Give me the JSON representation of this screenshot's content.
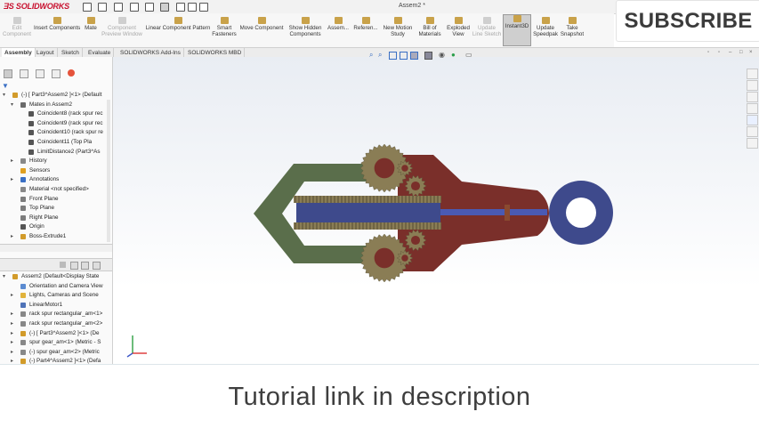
{
  "app": {
    "logo_text": "SOLIDWORKS",
    "doc_title": "Assem2 *"
  },
  "subscribe_label": "SUBSCRIBE",
  "caption": "Tutorial link in description",
  "commands": [
    {
      "label": "Edit\nComponent",
      "enabled": false
    },
    {
      "label": "Insert Components",
      "enabled": true
    },
    {
      "label": "Mate",
      "enabled": true
    },
    {
      "label": "Component\nPreview Window",
      "enabled": false
    },
    {
      "label": "Linear Component Pattern",
      "enabled": true
    },
    {
      "label": "Smart\nFasteners",
      "enabled": true
    },
    {
      "label": "Move Component",
      "enabled": true
    },
    {
      "label": "Show Hidden\nComponents",
      "enabled": true
    },
    {
      "label": "Assem...",
      "enabled": true
    },
    {
      "label": "Referen...",
      "enabled": true
    },
    {
      "label": "New Motion\nStudy",
      "enabled": true
    },
    {
      "label": "Bill of\nMaterials",
      "enabled": true
    },
    {
      "label": "Exploded\nView",
      "enabled": true
    },
    {
      "label": "Update\nLine Sketch",
      "enabled": false
    },
    {
      "label": "Instant3D",
      "enabled": true,
      "active": true
    },
    {
      "label": "Update\nSpeedpak",
      "enabled": true
    },
    {
      "label": "Take\nSnapshot",
      "enabled": true
    }
  ],
  "tabs": [
    "Assembly",
    "Layout",
    "Sketch",
    "Evaluate",
    "SOLIDWORKS Add-Ins",
    "SOLIDWORKS MBD"
  ],
  "feature_tree": [
    {
      "label": "(-) [ Part3^Assem2 ]<1> (Default",
      "indent": 0,
      "expand": "▾",
      "icon": "#d29b2a"
    },
    {
      "label": "Mates in Assem2",
      "indent": 1,
      "expand": "▾",
      "icon": "#6a6a6a"
    },
    {
      "label": "Coincident8 (rack spur rec",
      "indent": 2,
      "expand": "",
      "icon": "#555"
    },
    {
      "label": "Coincident9 (rack spur rec",
      "indent": 2,
      "expand": "",
      "icon": "#555"
    },
    {
      "label": "Coincident10 (rack spur re",
      "indent": 2,
      "expand": "",
      "icon": "#555"
    },
    {
      "label": "Coincident11 (Top Pla",
      "indent": 2,
      "expand": "",
      "icon": "#555"
    },
    {
      "label": "LimitDistance2 (Part3^As",
      "indent": 2,
      "expand": "",
      "icon": "#555"
    },
    {
      "label": "History",
      "indent": 1,
      "expand": "▸",
      "icon": "#888"
    },
    {
      "label": "Sensors",
      "indent": 1,
      "expand": "",
      "icon": "#e0a020"
    },
    {
      "label": "Annotations",
      "indent": 1,
      "expand": "▸",
      "icon": "#3a6fc4"
    },
    {
      "label": "Material <not specified>",
      "indent": 1,
      "expand": "",
      "icon": "#888"
    },
    {
      "label": "Front Plane",
      "indent": 1,
      "expand": "",
      "icon": "#7d7d7d"
    },
    {
      "label": "Top Plane",
      "indent": 1,
      "expand": "",
      "icon": "#7d7d7d"
    },
    {
      "label": "Right Plane",
      "indent": 1,
      "expand": "",
      "icon": "#7d7d7d"
    },
    {
      "label": "Origin",
      "indent": 1,
      "expand": "",
      "icon": "#555"
    },
    {
      "label": "Boss-Extrude1",
      "indent": 1,
      "expand": "▸",
      "icon": "#d29b2a"
    }
  ],
  "tree2": [
    {
      "label": "Assem2  (Default<Display State",
      "indent": 0,
      "expand": "▾",
      "icon": "#d29b2a"
    },
    {
      "label": "Orientation and Camera View",
      "indent": 1,
      "expand": "",
      "icon": "#5b8bd1"
    },
    {
      "label": "Lights, Cameras and Scene",
      "indent": 1,
      "expand": "▸",
      "icon": "#e1b33c"
    },
    {
      "label": "LinearMotor1",
      "indent": 1,
      "expand": "",
      "icon": "#4f73b8"
    },
    {
      "label": "rack spur rectangular_am<1>",
      "indent": 1,
      "expand": "▸",
      "icon": "#888"
    },
    {
      "label": "rack spur rectangular_am<2>",
      "indent": 1,
      "expand": "▸",
      "icon": "#888"
    },
    {
      "label": "(-) [ Part3^Assem2 ]<1> (De",
      "indent": 1,
      "expand": "▸",
      "icon": "#d29b2a"
    },
    {
      "label": "spur gear_am<1> (Metric - S",
      "indent": 1,
      "expand": "▸",
      "icon": "#888"
    },
    {
      "label": "(-) spur gear_am<2> (Metric",
      "indent": 1,
      "expand": "▸",
      "icon": "#888"
    },
    {
      "label": "(-) Part4^Assem2 ]<1> (Defa",
      "indent": 1,
      "expand": "▸",
      "icon": "#d29b2a"
    }
  ],
  "colors": {
    "gripper": "#5a6e4b",
    "body": "#7a2f2a",
    "rack": "#3e4a8c",
    "rod": "#4a5ab3",
    "ring": "#3e4a8c",
    "gear": "#8a7d55",
    "gear_hub": "#7a2f2a",
    "small_gear": "#7a2f2a"
  }
}
